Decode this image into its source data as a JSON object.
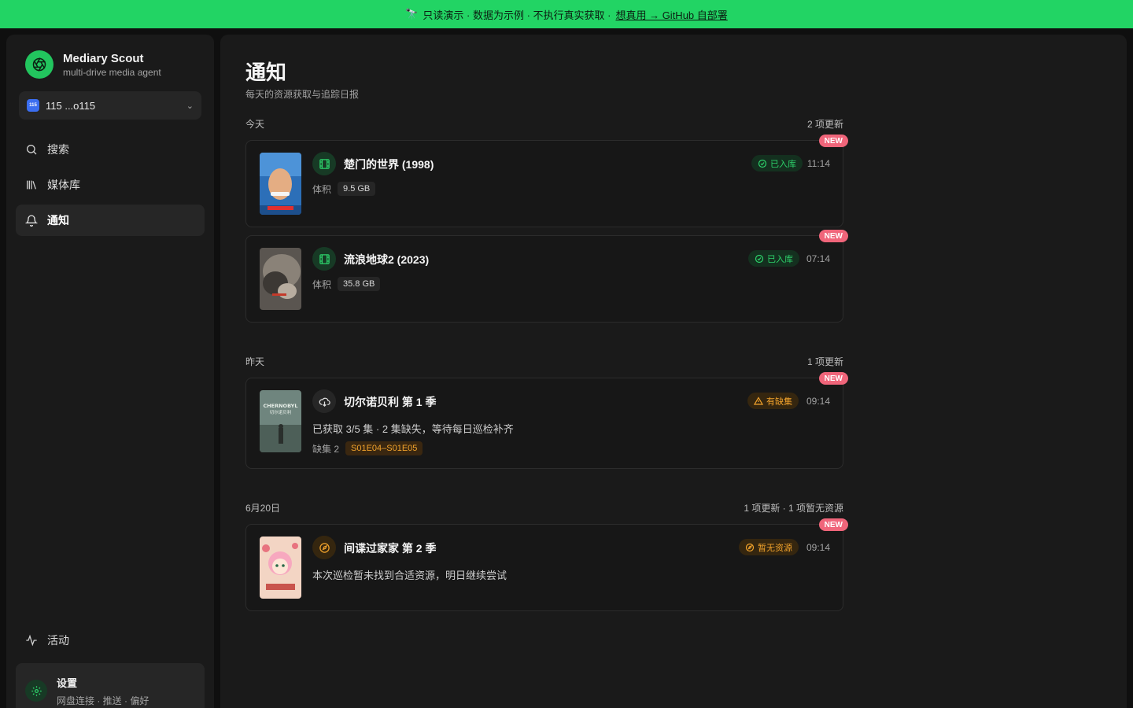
{
  "banner": {
    "text": "只读演示 · 数据为示例 · 不执行真实获取 ·",
    "link": "想真用 → GitHub 自部署"
  },
  "brand": {
    "name": "Mediary Scout",
    "subtitle": "multi-drive media agent"
  },
  "drive": {
    "badge": "115",
    "label": "115 ...o115"
  },
  "nav": {
    "search": "搜索",
    "library": "媒体库",
    "notifications": "通知",
    "activity": "活动"
  },
  "settings": {
    "title": "设置",
    "subtitle": "网盘连接 · 推送 · 偏好"
  },
  "page": {
    "title": "通知",
    "subtitle": "每天的资源获取与追踪日报"
  },
  "sections": [
    {
      "label": "今天",
      "count": "2 项更新",
      "items": [
        {
          "title": "楚门的世界 (1998)",
          "status": "已入库",
          "time": "11:14",
          "badge": "NEW",
          "meta_label": "体积",
          "meta_value": "9.5 GB"
        },
        {
          "title": "流浪地球2 (2023)",
          "status": "已入库",
          "time": "07:14",
          "badge": "NEW",
          "meta_label": "体积",
          "meta_value": "35.8 GB"
        }
      ]
    },
    {
      "label": "昨天",
      "count": "1 项更新",
      "items": [
        {
          "title": "切尔诺贝利 第 1 季",
          "status": "有缺集",
          "time": "09:14",
          "badge": "NEW",
          "desc": "已获取 3/5 集 · 2 集缺失，等待每日巡检补齐",
          "meta_label": "缺集 2",
          "meta_value": "S01E04–S01E05"
        }
      ]
    },
    {
      "label": "6月20日",
      "count": "1 项更新 · 1 项暂无资源",
      "items": [
        {
          "title": "间谍过家家 第 2 季",
          "status": "暂无资源",
          "time": "09:14",
          "badge": "NEW",
          "desc": "本次巡检暂未找到合适资源，明日继续尝试"
        }
      ]
    }
  ],
  "posters": {
    "chernobyl_title": "CHERNOBYL",
    "chernobyl_sub": "切尔诺贝利"
  },
  "colors": {
    "accent": "#22c55e",
    "banner": "#22d464",
    "warning": "#f2a32c",
    "new_badge": "#f0657a"
  },
  "icons": [
    "telescope-icon",
    "aperture-logo-icon",
    "search-icon",
    "library-icon",
    "bell-icon",
    "activity-icon",
    "gear-icon",
    "film-icon",
    "cloud-download-icon",
    "compass-icon",
    "check-circle-icon",
    "warning-icon",
    "chevron-down-icon"
  ]
}
